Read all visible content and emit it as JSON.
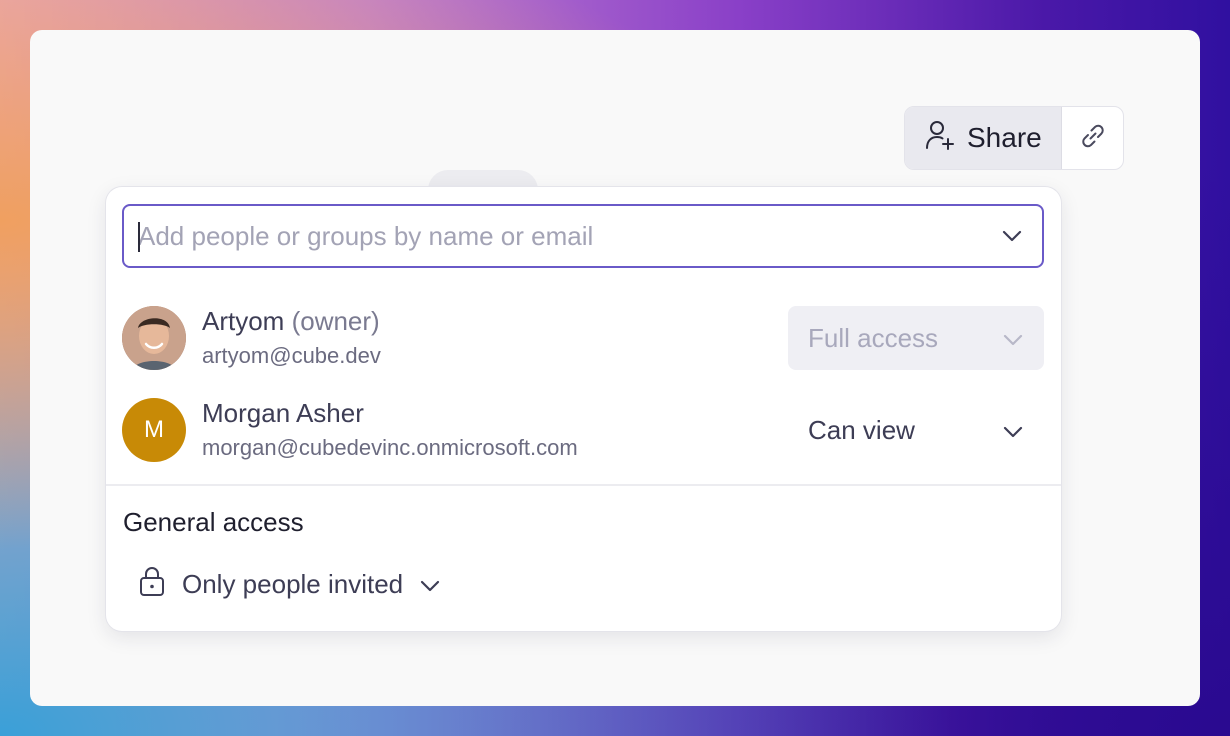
{
  "toolbar": {
    "share_label": "Share",
    "share_icon": "user-plus-icon",
    "link_icon": "link-icon"
  },
  "share_dialog": {
    "search": {
      "placeholder": "Add people or groups by name or email",
      "value": ""
    },
    "members": [
      {
        "name": "Artyom",
        "role": "(owner)",
        "email": "artyom@cube.dev",
        "avatar": "photo",
        "permission": "Full access",
        "permission_disabled": true
      },
      {
        "name": "Morgan Asher",
        "role": "",
        "email": "morgan@cubedevinc.onmicrosoft.com",
        "avatar_initial": "M",
        "avatar_color": "#c88a06",
        "permission": "Can view",
        "permission_disabled": false
      }
    ],
    "general_access": {
      "title": "General access",
      "value": "Only people invited",
      "icon": "lock-icon"
    }
  },
  "colors": {
    "accent_border": "#6a5ac8",
    "text_primary": "#3d3d55"
  }
}
